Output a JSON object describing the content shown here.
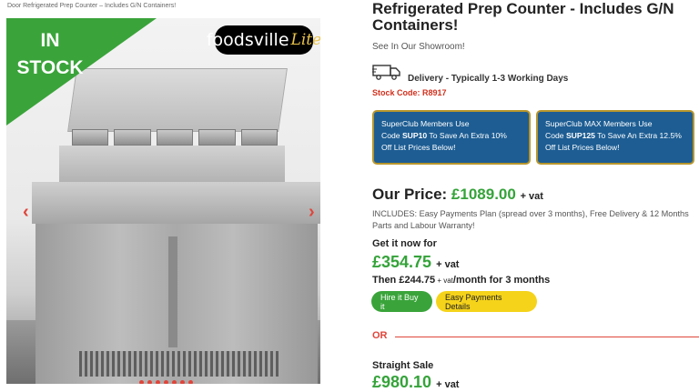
{
  "breadcrumb": "Door Refrigerated Prep Counter – Includes G/N Containers!",
  "gallery": {
    "ribbon_line1": "IN",
    "ribbon_line2": "STOCK",
    "logo_main": "foodsville",
    "logo_sub": "Lite",
    "prev_icon": "chevron-left-icon",
    "next_icon": "chevron-right-icon",
    "dot_count": 7
  },
  "product": {
    "title": "Refrigerated Prep Counter - Includes G/N Containers!",
    "showroom": "See In Our Showroom!",
    "delivery": "Delivery - Typically 1-3 Working Days",
    "stock_code": "Stock Code: R8917"
  },
  "promos": [
    {
      "line1": "SuperClub Members Use",
      "code_prefix": "Code ",
      "code": "SUP10",
      "line2_rest": " To Save An Extra 10%",
      "line3": "Off List Prices Below!"
    },
    {
      "line1": "SuperClub MAX Members Use",
      "code_prefix": "Code ",
      "code": "SUP125",
      "line2_rest": " To Save An Extra 12.5%",
      "line3": "Off List Prices Below!"
    }
  ],
  "pricing": {
    "our_price_label": "Our Price: ",
    "our_price": "£1089.00",
    "vat": "+ vat",
    "includes": "INCLUDES: Easy Payments Plan (spread over 3 months), Free Delivery & 12 Months Parts and Labour Warranty!",
    "get_now_label": "Get it now for",
    "now_price": "£354.75",
    "then_prefix": "Then ",
    "then_price": "£244.75",
    "then_vat": " + vat",
    "then_suffix": "/month for 3 months",
    "hire_button": "Hire it Buy it",
    "easy_button": "Easy Payments Details",
    "or_label": "OR",
    "straight_label": "Straight Sale",
    "straight_price": "£980.10"
  },
  "colors": {
    "accent_green": "#35a33a",
    "accent_red": "#e0453a",
    "promo_blue": "#1d5d93",
    "button_yellow": "#f5d31a"
  }
}
